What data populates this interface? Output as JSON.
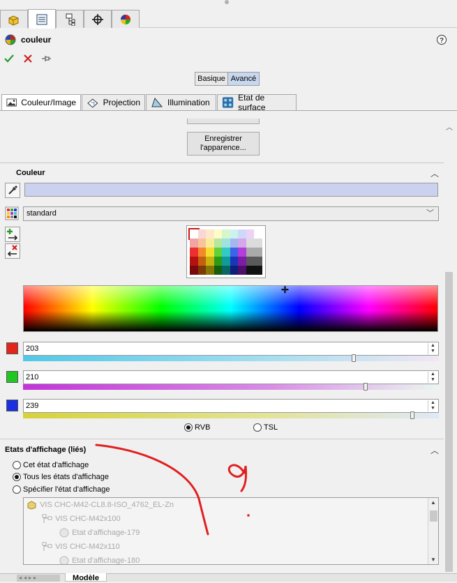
{
  "top_tabs": [
    {
      "icon": "feature-manager-icon"
    },
    {
      "icon": "property-manager-icon"
    },
    {
      "icon": "configuration-manager-icon"
    },
    {
      "icon": "dimxpert-icon"
    },
    {
      "icon": "display-manager-icon"
    }
  ],
  "header": {
    "title": "couleur",
    "help_icon": "help-icon",
    "ok_icon": "checkmark-icon",
    "cancel_icon": "close-icon",
    "pin_icon": "pushpin-icon"
  },
  "mode_toggle": {
    "basic": "Basique",
    "advanced": "Avancé",
    "selected": "Avancé"
  },
  "property_tabs": [
    {
      "label": "Couleur/Image",
      "icon": "color-image-icon"
    },
    {
      "label": "Projection",
      "icon": "projection-icon"
    },
    {
      "label": "Illumination",
      "icon": "illumination-icon"
    },
    {
      "label": "Etat de surface",
      "icon": "surface-finish-icon"
    }
  ],
  "save_appearance": {
    "line1": "Enregistrer",
    "line2": "l'apparence..."
  },
  "color_section": {
    "title": "Couleur",
    "current_color": "#cbd2ef",
    "palette_value": "standard",
    "swatches": [
      [
        "#ffffff",
        "#fcd6d6",
        "#fde9c9",
        "#fefbc8",
        "#d6f6cc",
        "#ccf2f0",
        "#cfd8f8",
        "#ecd3f6",
        "#ffffff"
      ],
      [
        "#f2a3a3",
        "#f7c39a",
        "#f8ec99",
        "#b4e89e",
        "#9ee3e0",
        "#a5b7f0",
        "#d6a6ea",
        "#dcdcdc",
        "#dcdcdc"
      ],
      [
        "#ec3030",
        "#f28a2a",
        "#f3dd2e",
        "#5ed13b",
        "#33c9c6",
        "#3d63e6",
        "#b23fd9",
        "#aaaaaa",
        "#aaaaaa"
      ],
      [
        "#b41111",
        "#c45f10",
        "#c7b20f",
        "#2b9a16",
        "#109a98",
        "#1a36b8",
        "#7d1ca6",
        "#5a5a5a",
        "#5a5a5a"
      ],
      [
        "#7a0909",
        "#7e3a06",
        "#857706",
        "#145f09",
        "#0a6664",
        "#0c1f7a",
        "#4d0f69",
        "#111111",
        "#111111"
      ]
    ],
    "channels": [
      {
        "name": "R",
        "value": "203",
        "fraction": 0.796,
        "swatch": "#e3261c",
        "track": "cyan-to-white"
      },
      {
        "name": "V",
        "value": "210",
        "fraction": 0.824,
        "swatch": "#22c622",
        "track": "magenta-to-white"
      },
      {
        "name": "B",
        "value": "239",
        "fraction": 0.937,
        "swatch": "#1a2fe0",
        "track": "yellow-to-white"
      }
    ],
    "mode_rgb": "RVB",
    "mode_hsl": "TSL",
    "selected_mode": "RVB"
  },
  "display_states": {
    "title": "Etats d'affichage (liés)",
    "options": [
      {
        "label": "Cet état d'affichage",
        "checked": false
      },
      {
        "label": "Tous les états d'affichage",
        "checked": true
      },
      {
        "label": "Spécifier l'état d'affichage",
        "checked": false
      }
    ],
    "tree": [
      {
        "label": "VIS CHC-M42-CL8.8-ISO_4762_EL-Zn",
        "icon": "part-icon",
        "level": 0
      },
      {
        "label": "VIS CHC-M42x100",
        "icon": "configuration-icon",
        "level": 1
      },
      {
        "label": "Etat d'affichage-179",
        "icon": "display-state-icon",
        "level": 2
      },
      {
        "label": "VIS CHC-M42x110",
        "icon": "configuration-icon",
        "level": 1
      },
      {
        "label": "Etat d'affichage-180",
        "icon": "display-state-icon",
        "level": 2
      }
    ]
  },
  "bottom_tabs": {
    "model_label": "Modèle"
  },
  "annotation": {
    "handwritten": "?",
    "color": "#e02020"
  }
}
